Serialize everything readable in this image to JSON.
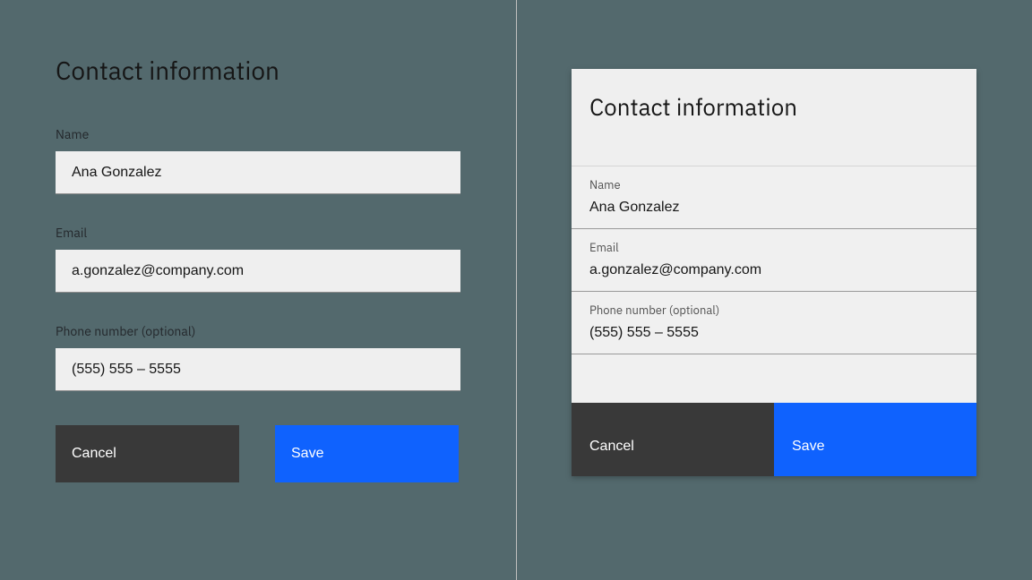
{
  "left": {
    "title": "Contact information",
    "fields": {
      "name": {
        "label": "Name",
        "value": "Ana Gonzalez"
      },
      "email": {
        "label": "Email",
        "value": "a.gonzalez@company.com"
      },
      "phone": {
        "label": "Phone number (optional)",
        "value": "(555) 555 – 5555"
      }
    },
    "buttons": {
      "cancel": "Cancel",
      "save": "Save"
    }
  },
  "right": {
    "title": "Contact information",
    "fields": {
      "name": {
        "label": "Name",
        "value": "Ana Gonzalez"
      },
      "email": {
        "label": "Email",
        "value": "a.gonzalez@company.com"
      },
      "phone": {
        "label": "Phone number (optional)",
        "value": "(555) 555 – 5555"
      }
    },
    "buttons": {
      "cancel": "Cancel",
      "save": "Save"
    }
  },
  "colors": {
    "primary": "#0f62fe",
    "secondary": "#393939"
  }
}
